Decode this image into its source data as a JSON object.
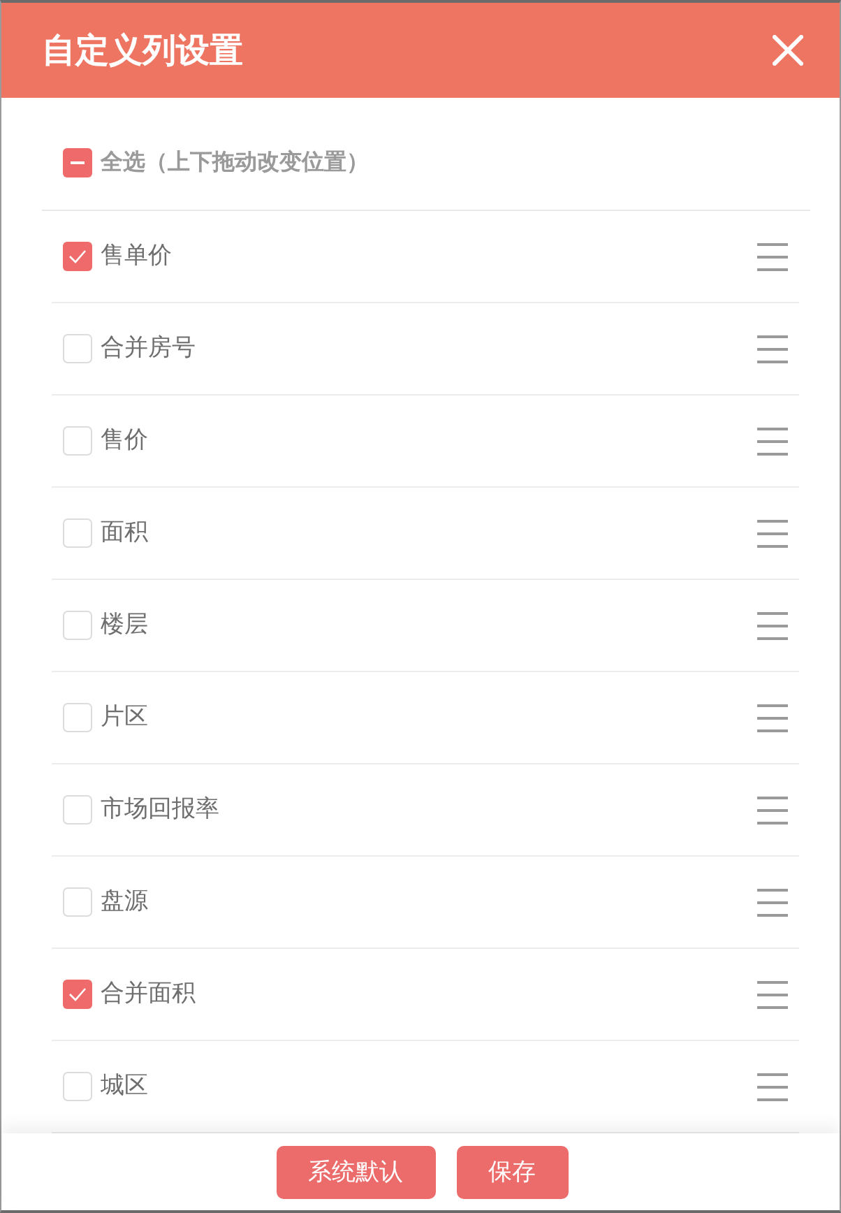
{
  "dialog": {
    "title": "自定义列设置"
  },
  "select_all": {
    "label": "全选（上下拖动改变位置）",
    "indeterminate": true
  },
  "columns": [
    {
      "label": "售单价",
      "checked": true
    },
    {
      "label": "合并房号",
      "checked": false
    },
    {
      "label": "售价",
      "checked": false
    },
    {
      "label": "面积",
      "checked": false
    },
    {
      "label": "楼层",
      "checked": false
    },
    {
      "label": "片区",
      "checked": false
    },
    {
      "label": "市场回报率",
      "checked": false
    },
    {
      "label": "盘源",
      "checked": false
    },
    {
      "label": "合并面积",
      "checked": true
    },
    {
      "label": "城区",
      "checked": false
    }
  ],
  "buttons": [
    {
      "label": "系统默认"
    },
    {
      "label": "保存"
    }
  ]
}
